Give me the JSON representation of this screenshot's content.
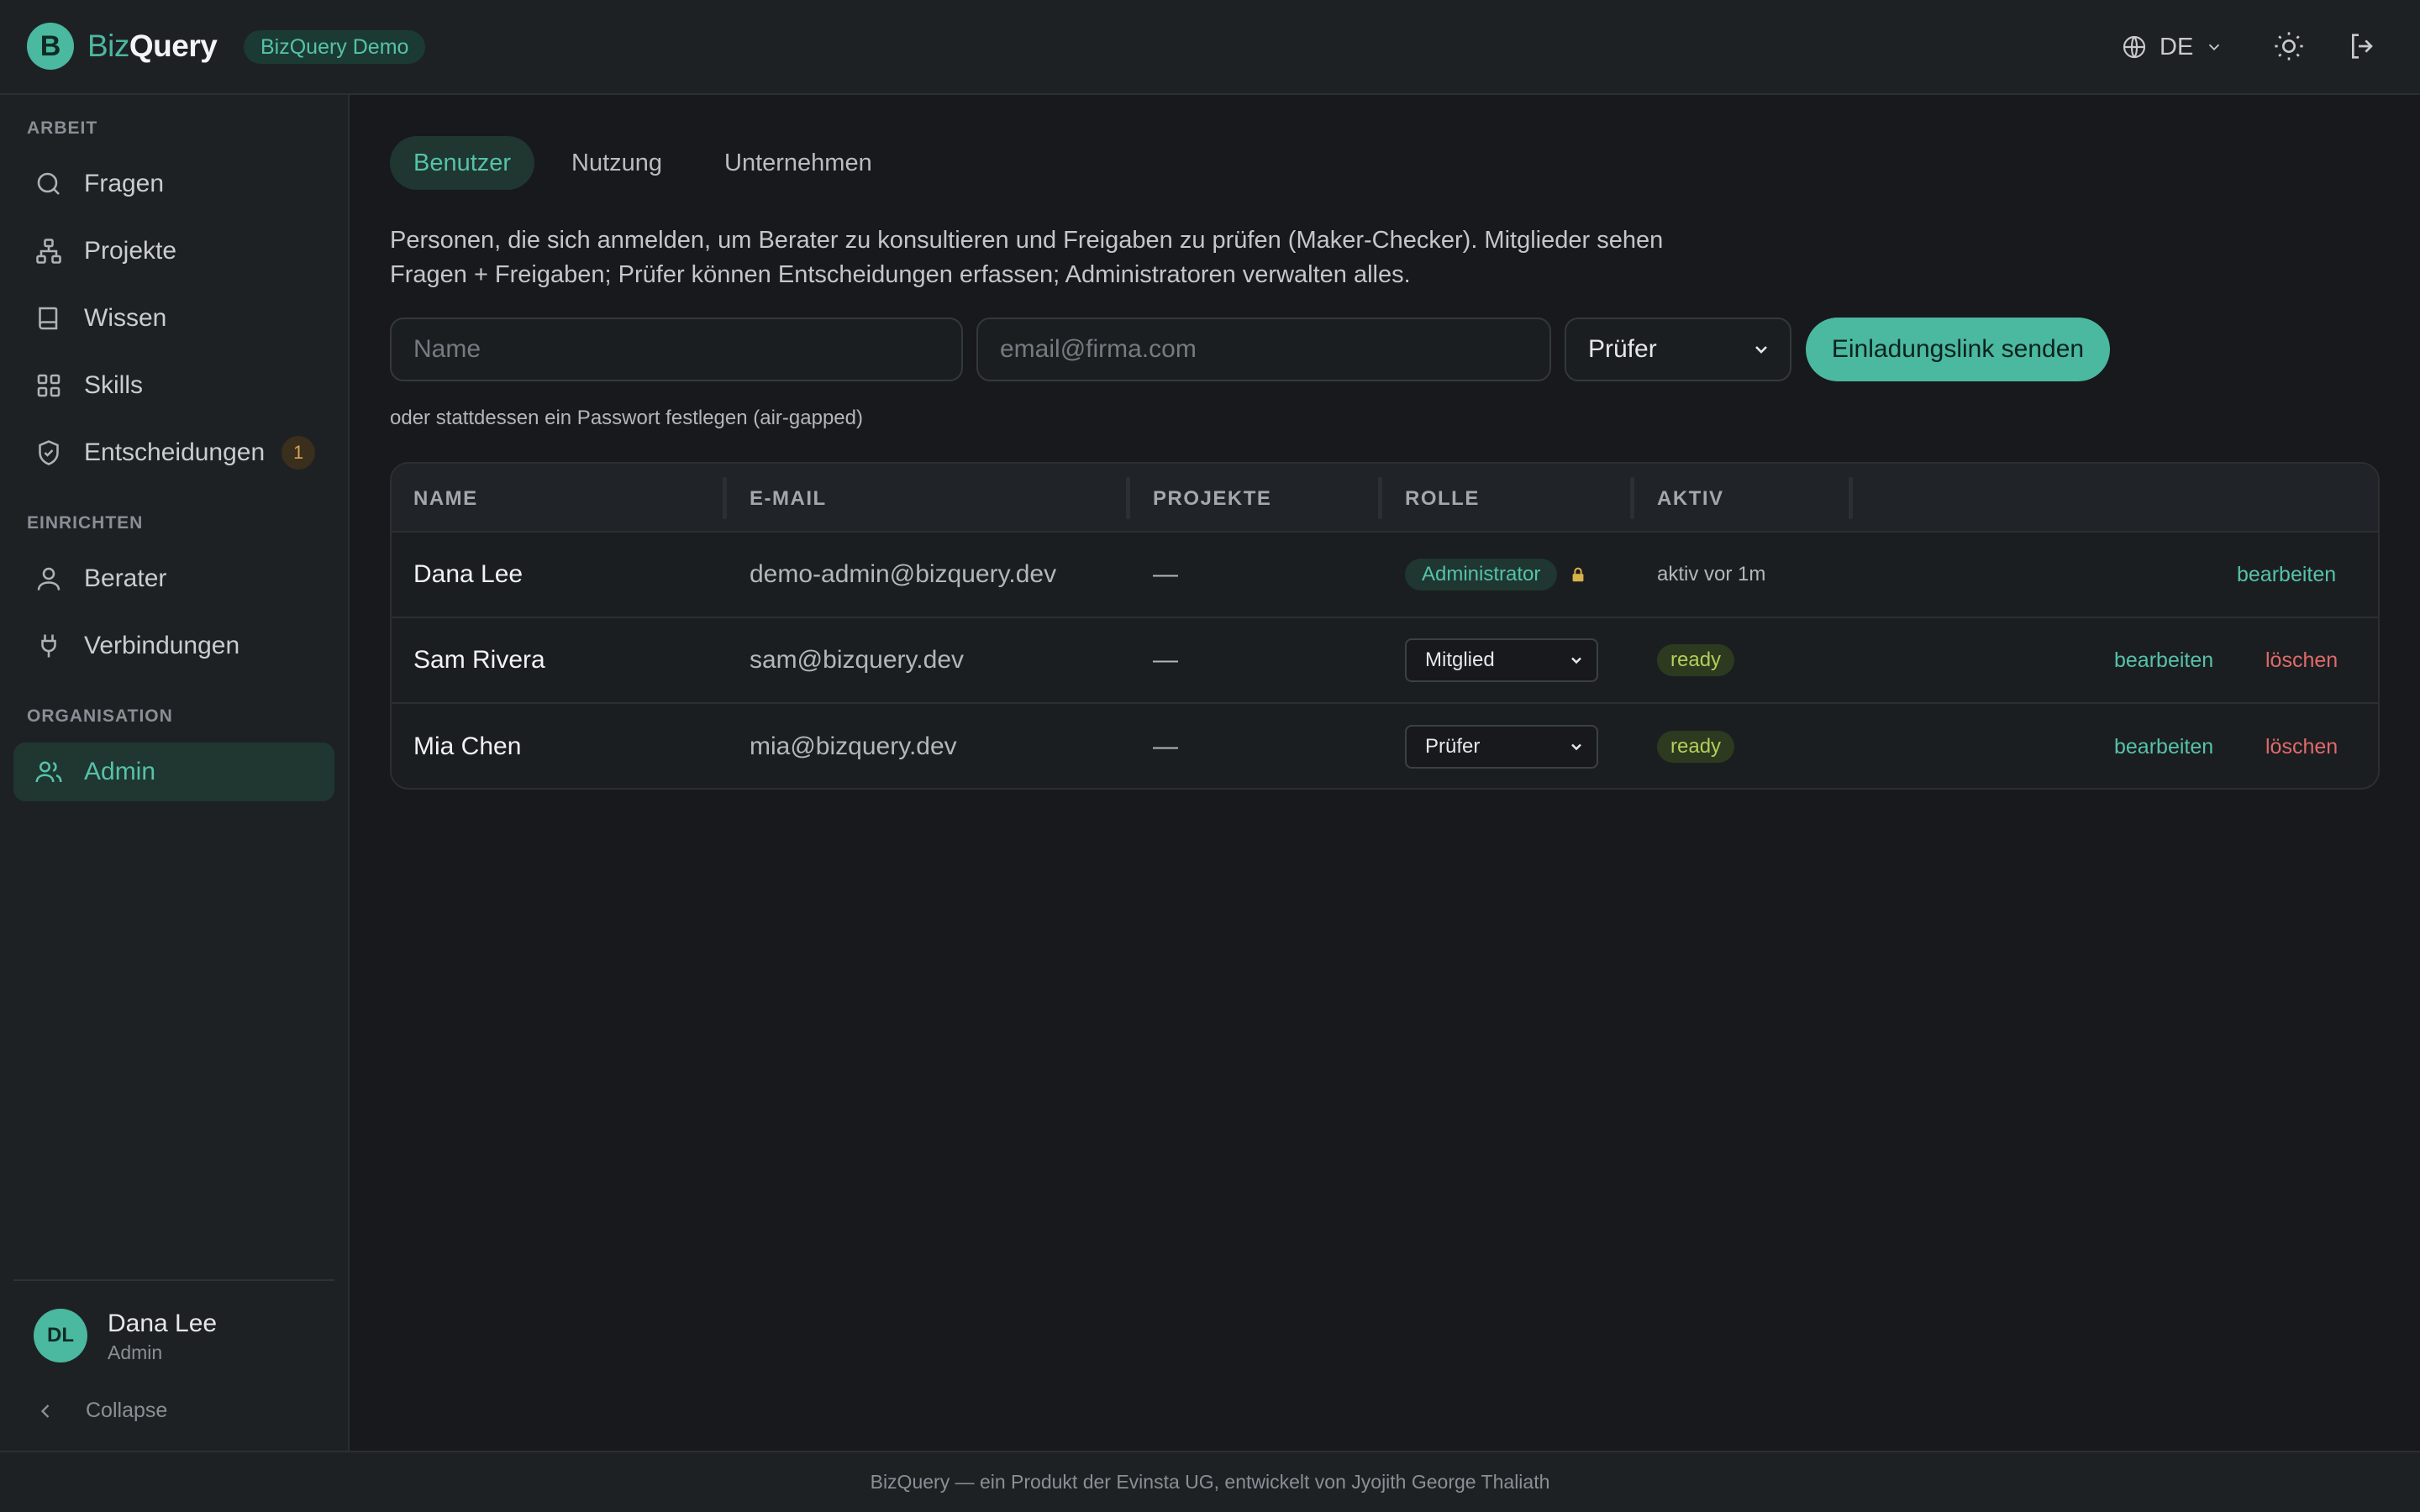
{
  "header": {
    "logo_letter": "B",
    "logo_biz": "Biz",
    "logo_query": "Query",
    "demo_badge": "BizQuery Demo",
    "language": "DE",
    "icons": [
      "globe-icon",
      "chevron-down-icon",
      "sun-icon",
      "logout-icon"
    ]
  },
  "sidebar": {
    "sections": [
      {
        "label": "ARBEIT"
      },
      {
        "label": "EINRICHTEN"
      },
      {
        "label": "ORGANISATION"
      }
    ],
    "items": [
      {
        "label": "Fragen",
        "icon": "search-icon"
      },
      {
        "label": "Projekte",
        "icon": "hierarchy-icon"
      },
      {
        "label": "Wissen",
        "icon": "book-icon"
      },
      {
        "label": "Skills",
        "icon": "grid-icon"
      },
      {
        "label": "Entscheidungen",
        "icon": "shield-check-icon",
        "badge": "1"
      },
      {
        "label": "Berater",
        "icon": "person-icon"
      },
      {
        "label": "Verbindungen",
        "icon": "plug-icon"
      },
      {
        "label": "Admin",
        "icon": "users-icon",
        "active": true
      }
    ],
    "user": {
      "initials": "DL",
      "name": "Dana Lee",
      "role": "Admin"
    },
    "collapse_label": "Collapse"
  },
  "main": {
    "tabs": [
      {
        "label": "Benutzer",
        "active": true
      },
      {
        "label": "Nutzung"
      },
      {
        "label": "Unternehmen"
      }
    ],
    "description": "Personen, die sich anmelden, um Berater zu konsultieren und Freigaben zu prüfen (Maker-Checker). Mitglieder sehen Fragen + Freigaben; Prüfer können Entscheidungen erfassen; Administratoren verwalten alles.",
    "invite": {
      "name_placeholder": "Name",
      "email_placeholder": "email@firma.com",
      "role_selected": "Prüfer",
      "send_label": "Einladungslink senden"
    },
    "password_link": "oder stattdessen ein Passwort festlegen (air-gapped)",
    "table": {
      "headers": [
        "NAME",
        "E-MAIL",
        "PROJEKTE",
        "ROLLE",
        "AKTIV"
      ],
      "rows": [
        {
          "name": "Dana Lee",
          "email": "demo-admin@bizquery.dev",
          "projects": "—",
          "role": "Administrator",
          "role_locked": true,
          "active": "aktiv vor 1m",
          "edit": "bearbeiten"
        },
        {
          "name": "Sam Rivera",
          "email": "sam@bizquery.dev",
          "projects": "—",
          "role": "Mitglied",
          "active": "ready",
          "edit": "bearbeiten",
          "delete": "löschen"
        },
        {
          "name": "Mia Chen",
          "email": "mia@bizquery.dev",
          "projects": "—",
          "role": "Prüfer",
          "active": "ready",
          "edit": "bearbeiten",
          "delete": "löschen"
        }
      ]
    }
  },
  "footer": {
    "text": "BizQuery — ein Produkt der Evinsta UG, entwickelt von Jyojith George Thaliath"
  },
  "colors": {
    "accent": "#4bb8a0",
    "danger": "#e06a6a",
    "ready": "#b4cf58",
    "warning": "#d8a257"
  }
}
